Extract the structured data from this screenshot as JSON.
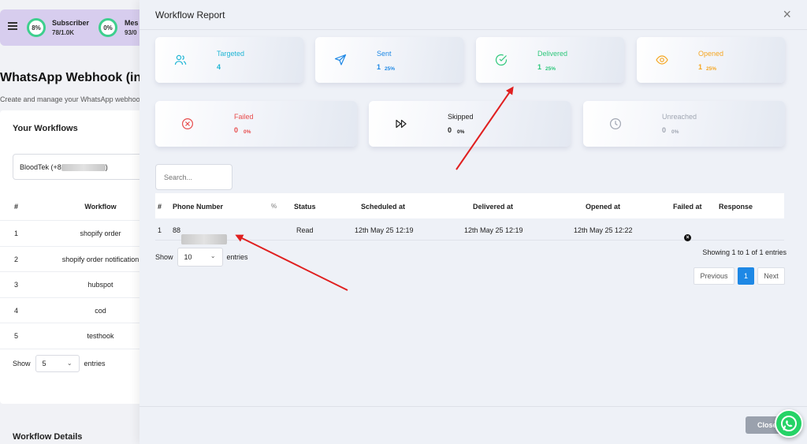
{
  "background": {
    "stats": [
      {
        "percent": "8%",
        "title": "Subscriber",
        "value": "78/1.0K"
      },
      {
        "percent": "0%",
        "title": "Mes",
        "value": "93/0"
      }
    ],
    "heading": "WhatsApp Webhook (in-b",
    "subheading": "Create and manage your WhatsApp webhoo",
    "card_title": "Your Workflows",
    "selected_account": "BloodTek (+8",
    "selected_account_suffix": ")",
    "table_headers": [
      "#",
      "Workflow"
    ],
    "workflows": [
      {
        "num": "1",
        "name": "shopify order"
      },
      {
        "num": "2",
        "name": "shopify order notification"
      },
      {
        "num": "3",
        "name": "hubspot"
      },
      {
        "num": "4",
        "name": "cod"
      },
      {
        "num": "5",
        "name": "testhook"
      }
    ],
    "show_label": "Show",
    "show_value": "5",
    "entries_label": "entries",
    "footer_title": "Workflow Details"
  },
  "modal": {
    "title": "Workflow Report",
    "close_x": "×",
    "stats": {
      "targeted": {
        "label": "Targeted",
        "count": "4",
        "color": "#1fb5d4"
      },
      "sent": {
        "label": "Sent",
        "count": "1",
        "pct": "25%",
        "color": "#1e88e5"
      },
      "delivered": {
        "label": "Delivered",
        "count": "1",
        "pct": "25%",
        "color": "#2ec77b"
      },
      "opened": {
        "label": "Opened",
        "count": "1",
        "pct": "25%",
        "color": "#f5a623"
      },
      "failed": {
        "label": "Failed",
        "count": "0",
        "pct": "0%",
        "color": "#e74c4c"
      },
      "skipped": {
        "label": "Skipped",
        "count": "0",
        "pct": "0%",
        "color": "#222222"
      },
      "unreached": {
        "label": "Unreached",
        "count": "0",
        "pct": "0%",
        "color": "#a0a6b2"
      }
    },
    "search_placeholder": "Search...",
    "table": {
      "headers": [
        "#",
        "Phone Number",
        "%",
        "Status",
        "Scheduled at",
        "Delivered at",
        "Opened at",
        "Failed at",
        "Response"
      ],
      "rows": [
        {
          "num": "1",
          "phone": "88",
          "status": "Read",
          "scheduled": "12th May 25 12:19",
          "delivered": "12th May 25 12:19",
          "opened": "12th May 25 12:22",
          "failed_icon": "x-circle-icon"
        }
      ]
    },
    "show_label": "Show",
    "show_value": "10",
    "entries_label": "entries",
    "showing_text": "Showing 1 to 1 of 1 entries",
    "pagination": {
      "previous": "Previous",
      "current": "1",
      "next": "Next"
    },
    "close_button": "Close"
  }
}
